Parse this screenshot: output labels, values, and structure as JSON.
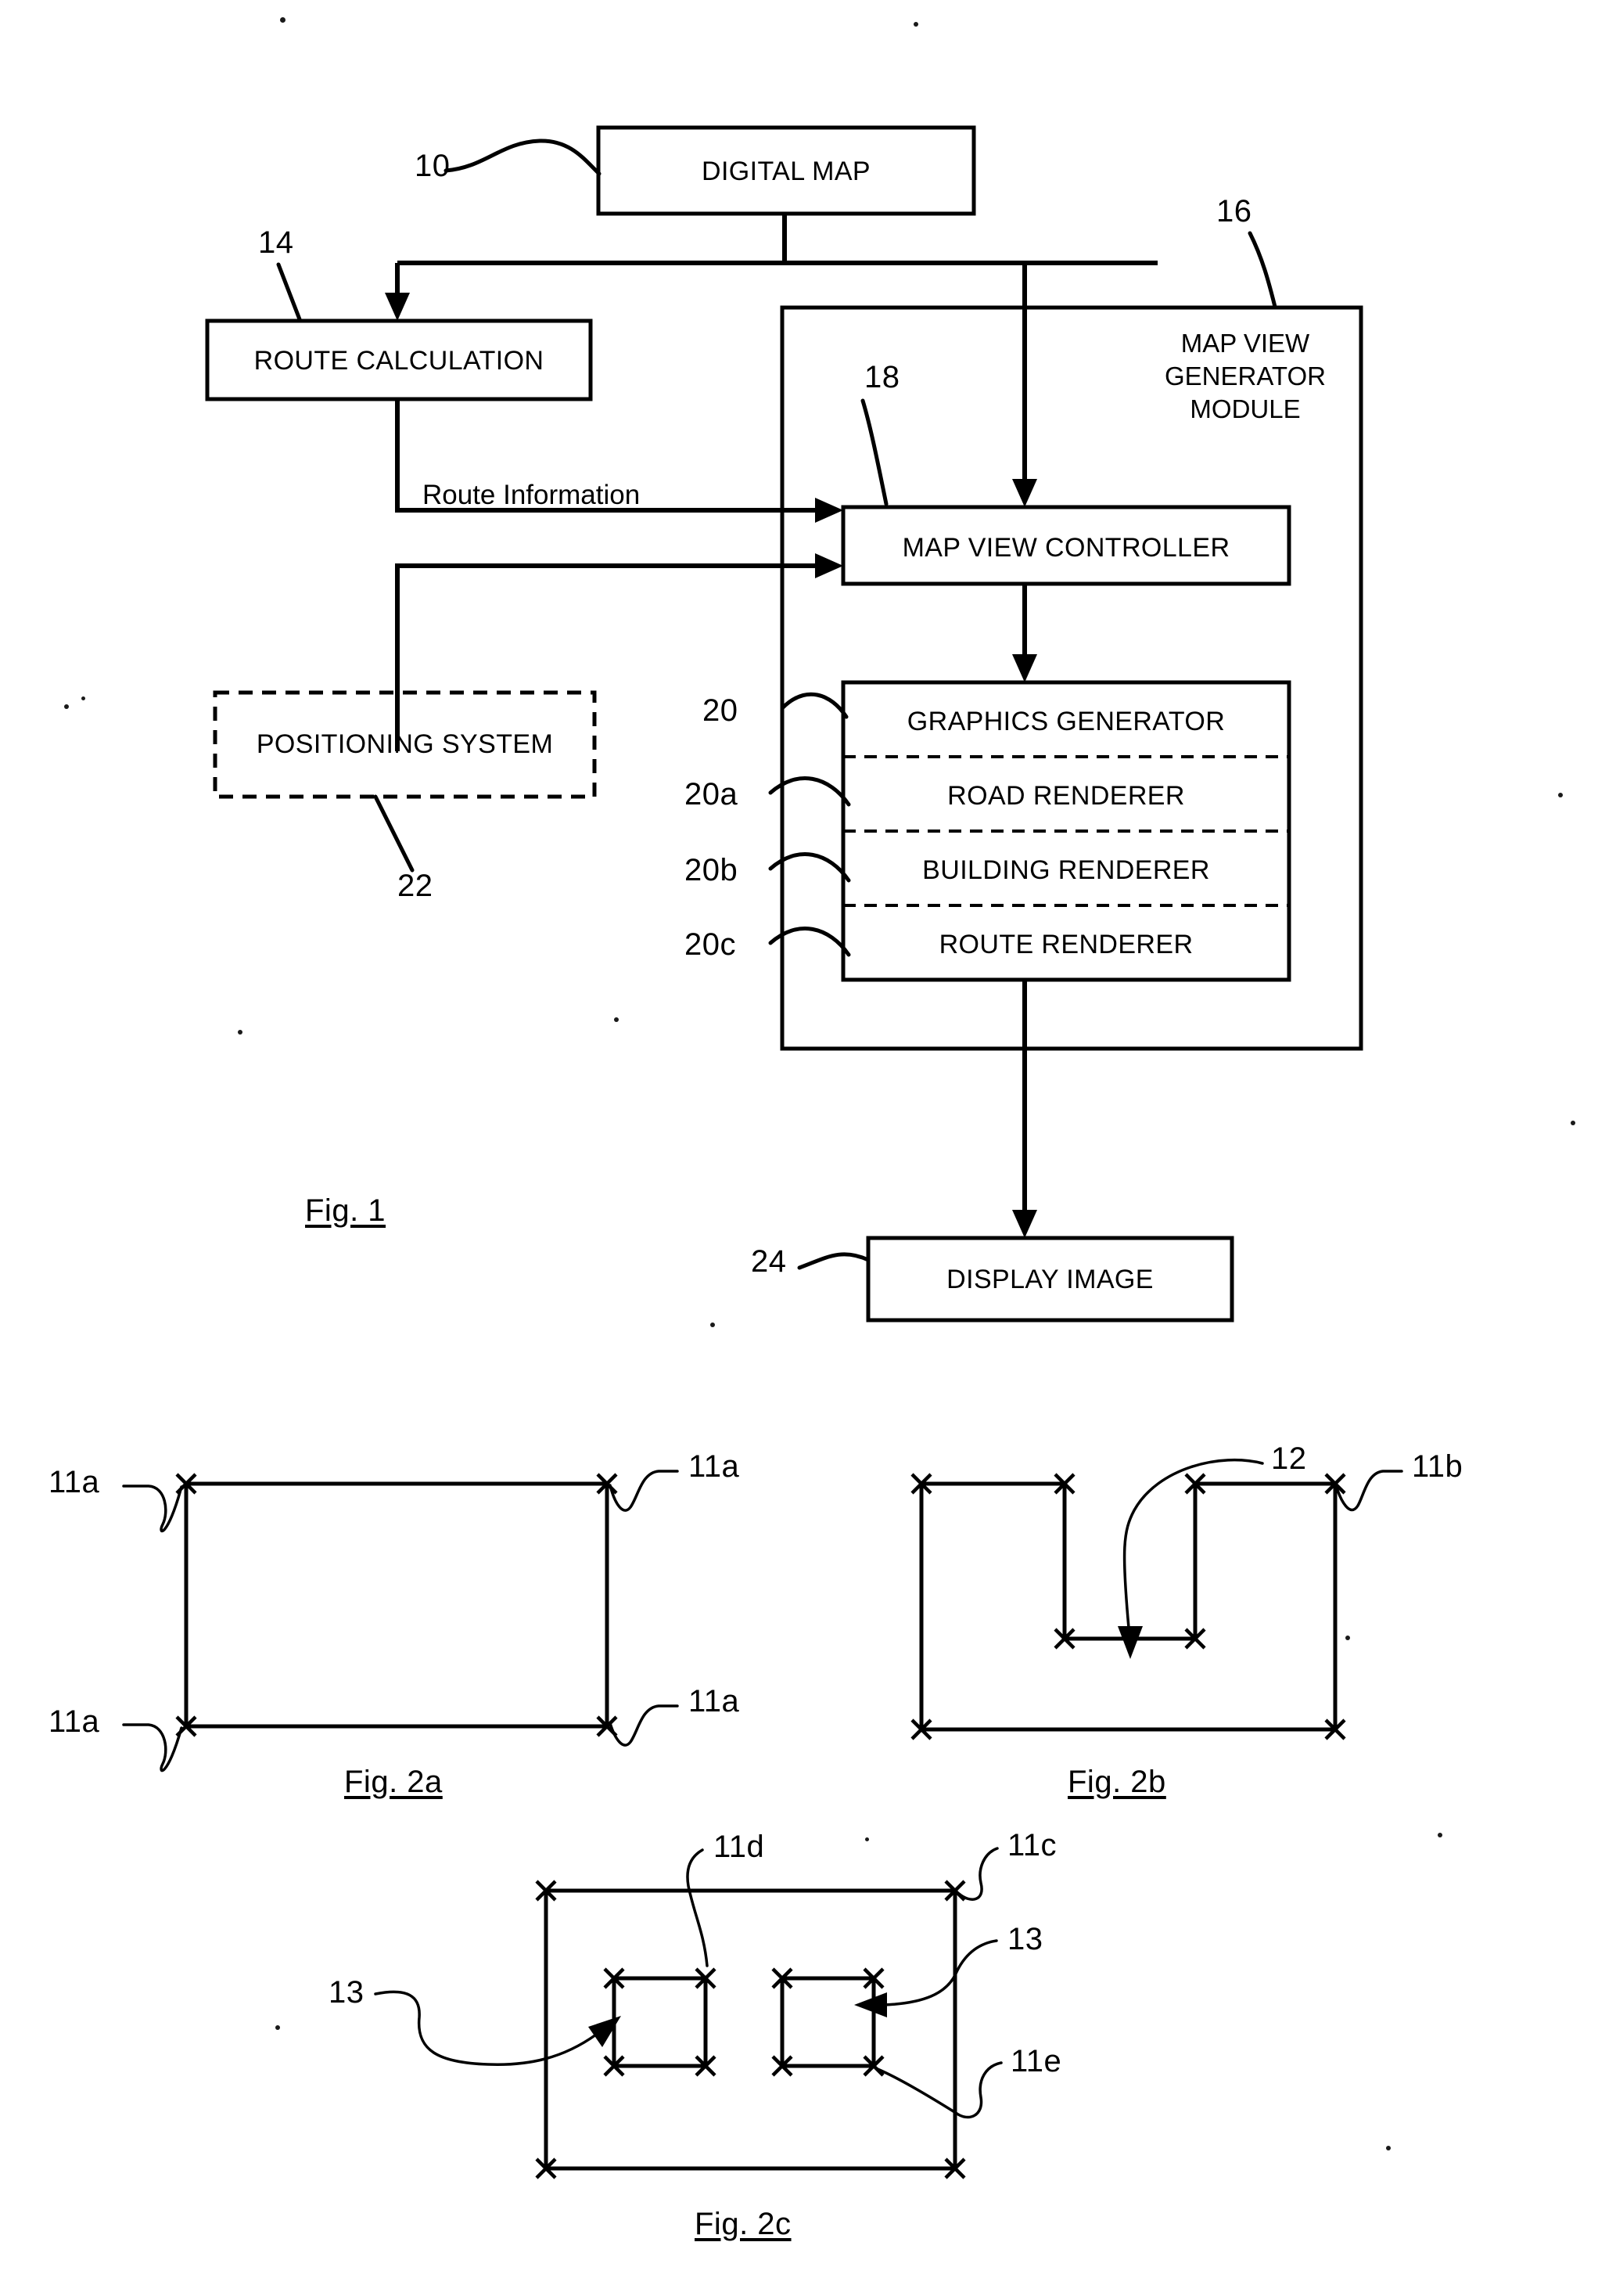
{
  "document": {
    "type": "patent-drawing-sheet",
    "figures": [
      "Fig. 1",
      "Fig. 2a",
      "Fig. 2b",
      "Fig. 2c"
    ]
  },
  "fig1": {
    "caption": "Fig. 1",
    "boxes": {
      "digital_map": {
        "label": "DIGITAL MAP",
        "ref": "10"
      },
      "route_calculation": {
        "label": "ROUTE CALCULATION",
        "ref": "14"
      },
      "positioning_system": {
        "label": "POSITIONING SYSTEM",
        "ref": "22",
        "style": "dashed"
      },
      "map_view_module": {
        "label": "MAP VIEW\nGENERATOR\nMODULE",
        "ref": "16"
      },
      "map_view_controller": {
        "label": "MAP VIEW CONTROLLER",
        "ref": "18"
      },
      "graphics_generator": {
        "label": "GRAPHICS GENERATOR",
        "ref": "20"
      },
      "road_renderer": {
        "label": "ROAD RENDERER",
        "ref": "20a"
      },
      "building_renderer": {
        "label": "BUILDING RENDERER",
        "ref": "20b"
      },
      "route_renderer": {
        "label": "ROUTE RENDERER",
        "ref": "20c"
      },
      "display_image": {
        "label": "DISPLAY IMAGE",
        "ref": "24"
      }
    },
    "edge_labels": {
      "route_information": "Route Information"
    }
  },
  "fig2a": {
    "caption": "Fig. 2a",
    "shape": "rectangle",
    "vertex_refs": [
      "11a",
      "11a",
      "11a",
      "11a"
    ],
    "refs": {
      "top_left": "11a",
      "top_right": "11a",
      "bottom_left": "11a",
      "bottom_right": "11a"
    }
  },
  "fig2b": {
    "caption": "Fig. 2b",
    "shape": "notched-rectangle",
    "refs": {
      "notch": "12",
      "outline": "11b"
    }
  },
  "fig2c": {
    "caption": "Fig. 2c",
    "shape": "rectangle-with-two-holes",
    "refs": {
      "outer_top": "11d",
      "outer_corner": "11c",
      "hole_right": "13",
      "hole_left": "13",
      "inner_bottom": "11e"
    }
  }
}
